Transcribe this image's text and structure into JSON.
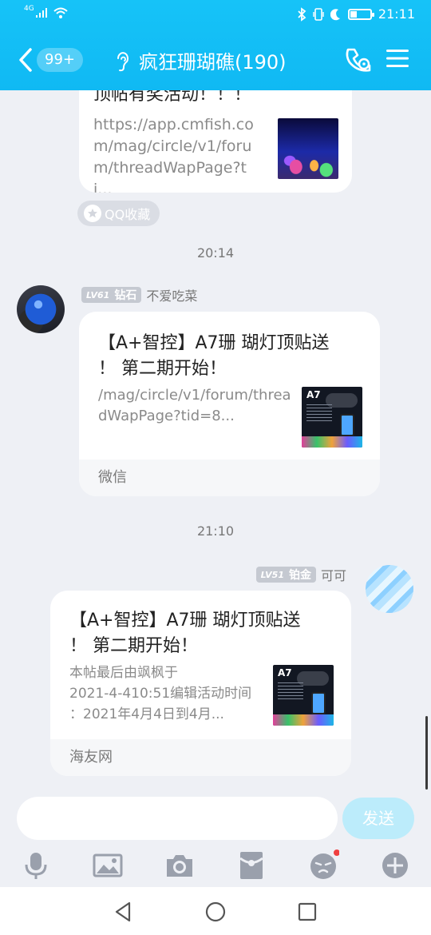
{
  "status_bar": {
    "network": "4G",
    "time": "21:11"
  },
  "header": {
    "unread_badge": "99+",
    "title": "疯狂珊瑚礁(190)"
  },
  "messages": {
    "first_card": {
      "title_tail": "顶帖有奖活动！！！",
      "url_lines": [
        "https://app.cmfish.co",
        "m/mag/circle/v1/foru",
        "m/threadWapPage?ti..."
      ]
    },
    "fav_tag": "QQ收藏",
    "time1": "20:14",
    "msg_left": {
      "level": "LV61",
      "rank": "钻石",
      "nickname": "不爱吃菜",
      "title_lines": [
        "【A+智控】A7珊 瑚灯顶贴送",
        "！ 第二期开始！"
      ],
      "desc_lines": [
        "/mag/circle/v1/forum/threa",
        "dWapPage?tid=8..."
      ],
      "thumb_label": "A7",
      "footer": "微信"
    },
    "time2": "21:10",
    "msg_right": {
      "level": "LV51",
      "rank": "铂金",
      "nickname": "可可",
      "title_lines": [
        "【A+智控】A7珊 瑚灯顶贴送",
        "！ 第二期开始！"
      ],
      "desc_lines": [
        "本帖最后由飒枫于",
        "2021-4-410:51编辑活动时间",
        "：2021年4月4日到4月..."
      ],
      "thumb_label": "A7",
      "footer": "海友网"
    }
  },
  "input": {
    "value": "",
    "placeholder": "",
    "send_label": "发送"
  },
  "colors": {
    "header": "#14bff6",
    "send_disabled": "#bcecfb",
    "notification_dot": "#f04040"
  }
}
